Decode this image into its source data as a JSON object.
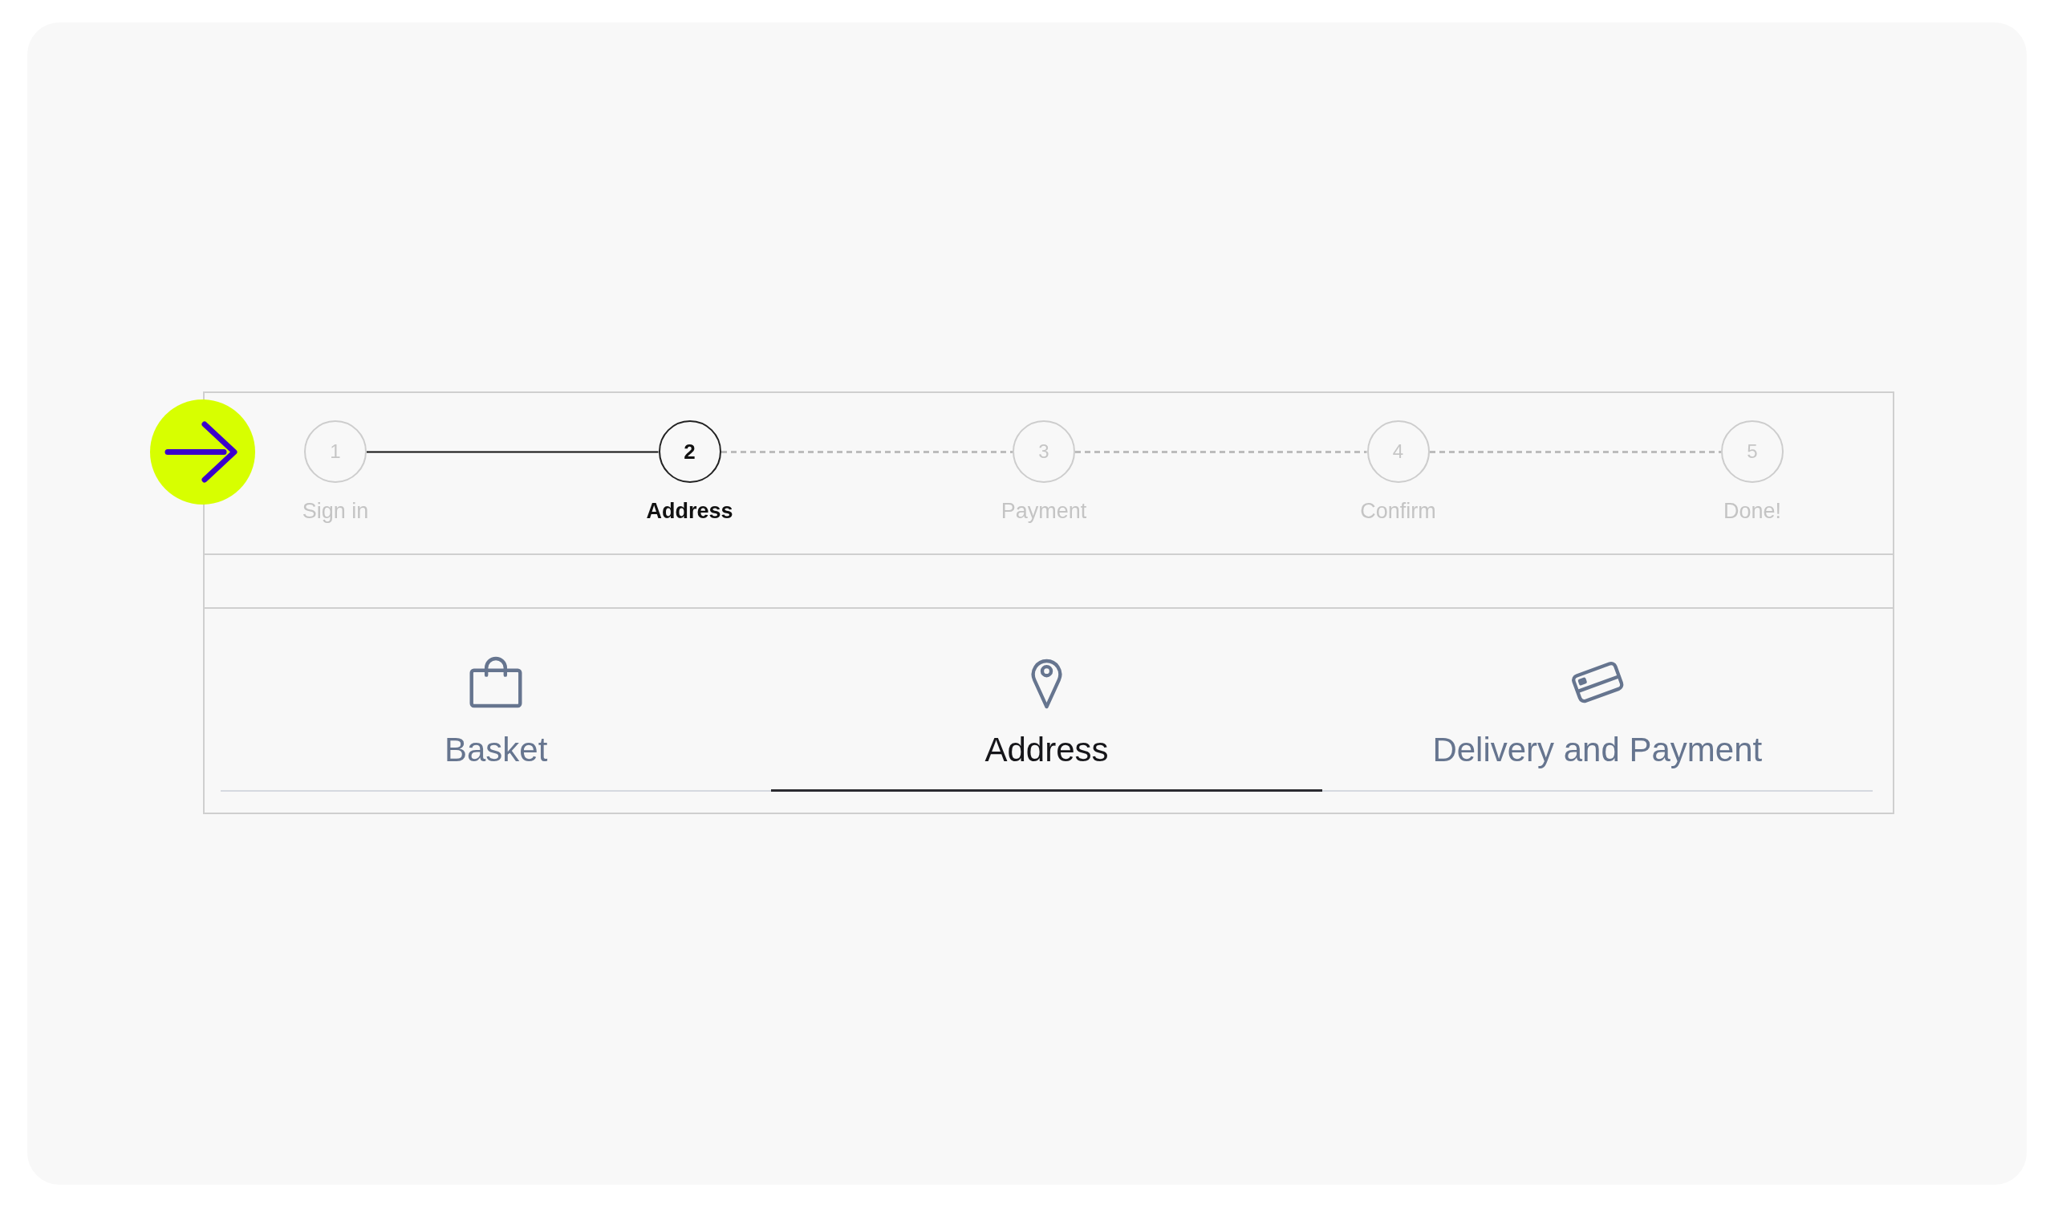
{
  "stepper": {
    "steps": [
      {
        "number": "1",
        "label": "Sign in",
        "selected": false
      },
      {
        "number": "2",
        "label": "Address",
        "selected": true
      },
      {
        "number": "3",
        "label": "Payment",
        "selected": false
      },
      {
        "number": "4",
        "label": "Confirm",
        "selected": false
      },
      {
        "number": "5",
        "label": "Done!",
        "selected": false
      }
    ]
  },
  "tabs": [
    {
      "label": "Basket",
      "kind": "bag",
      "selected": false
    },
    {
      "label": "Address",
      "kind": "pin",
      "selected": true
    },
    {
      "label": "Delivery and Payment",
      "kind": "card",
      "selected": false
    }
  ]
}
